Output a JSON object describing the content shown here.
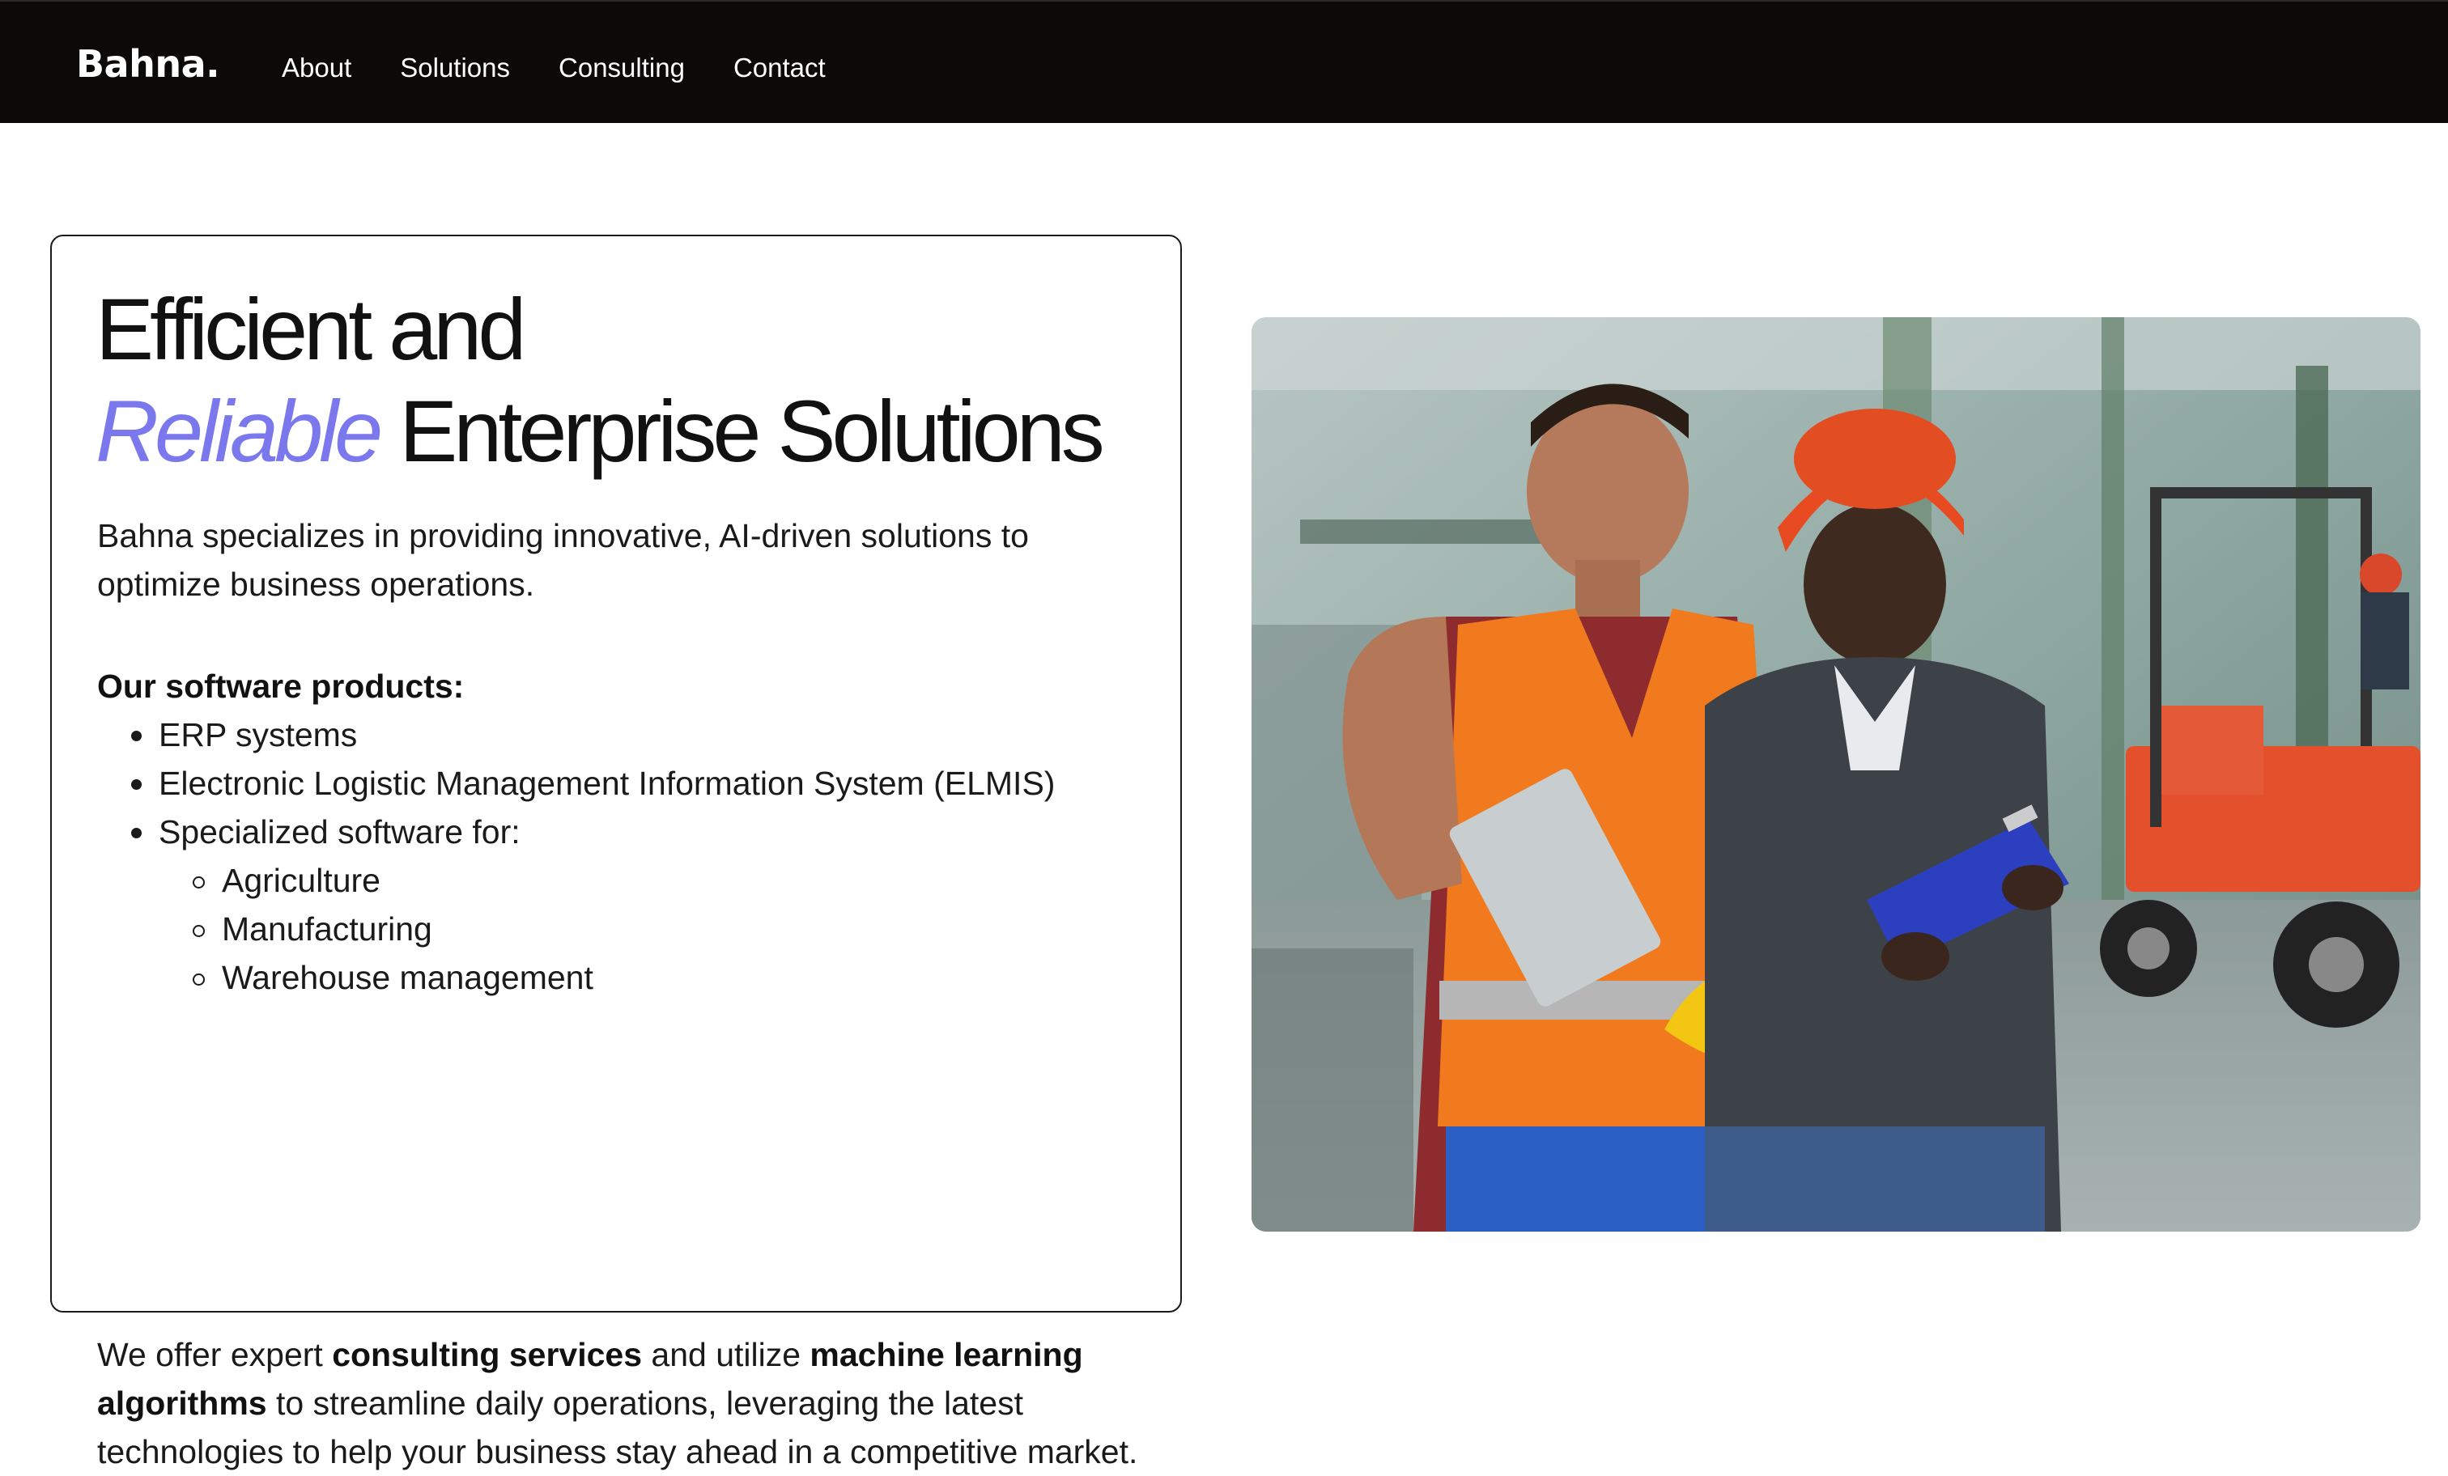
{
  "header": {
    "logo": "Bahna.",
    "nav": [
      "About",
      "Solutions",
      "Consulting",
      "Contact"
    ]
  },
  "hero": {
    "headline_line1": "Efficient and",
    "headline_accent": "Reliable",
    "headline_rest": " Enterprise Solutions",
    "intro": "Bahna specializes in providing innovative, AI-driven solutions to optimize business operations.",
    "products_title": "Our software products:",
    "products": [
      "ERP systems",
      "Electronic Logistic Management Information System (ELMIS)",
      "Specialized software for:"
    ],
    "specialized": [
      "Agriculture",
      "Manufacturing",
      "Warehouse management"
    ],
    "outro_parts": {
      "p1": "We offer expert ",
      "b1": "consulting services",
      "p2": " and utilize ",
      "b2": "machine learning algorithms",
      "p3": " to streamline daily operations, leveraging the latest technologies to help your business stay ahead in a competitive market."
    }
  },
  "image": {
    "subject": "factory-workers-photo"
  },
  "colors": {
    "header_bg": "#0b0a09",
    "accent": "#7b78ee",
    "text": "#111111"
  }
}
